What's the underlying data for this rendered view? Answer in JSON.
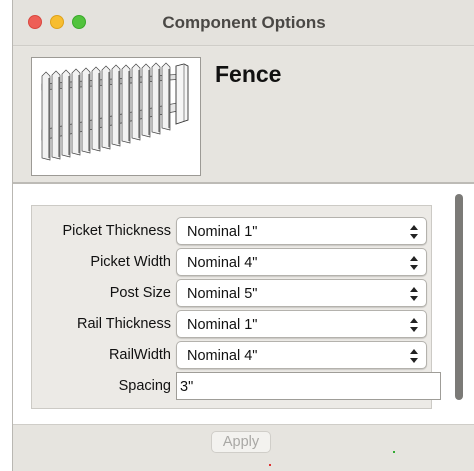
{
  "window": {
    "title": "Component Options"
  },
  "component": {
    "name": "Fence",
    "thumbnail": "fence-thumbnail"
  },
  "options": [
    {
      "label": "Picket Thickness",
      "type": "select",
      "value": "Nominal 1\""
    },
    {
      "label": "Picket Width",
      "type": "select",
      "value": "Nominal 4\""
    },
    {
      "label": "Post Size",
      "type": "select",
      "value": "Nominal 5\""
    },
    {
      "label": "Rail Thickness",
      "type": "select",
      "value": "Nominal 1\""
    },
    {
      "label": "RailWidth",
      "type": "select",
      "value": "Nominal 4\""
    },
    {
      "label": "Spacing",
      "type": "text",
      "value": "3\""
    }
  ],
  "footer": {
    "apply_label": "Apply"
  },
  "colors": {
    "close": "#ee5f57",
    "minimize": "#f7bd30",
    "maximize": "#52c33d"
  }
}
